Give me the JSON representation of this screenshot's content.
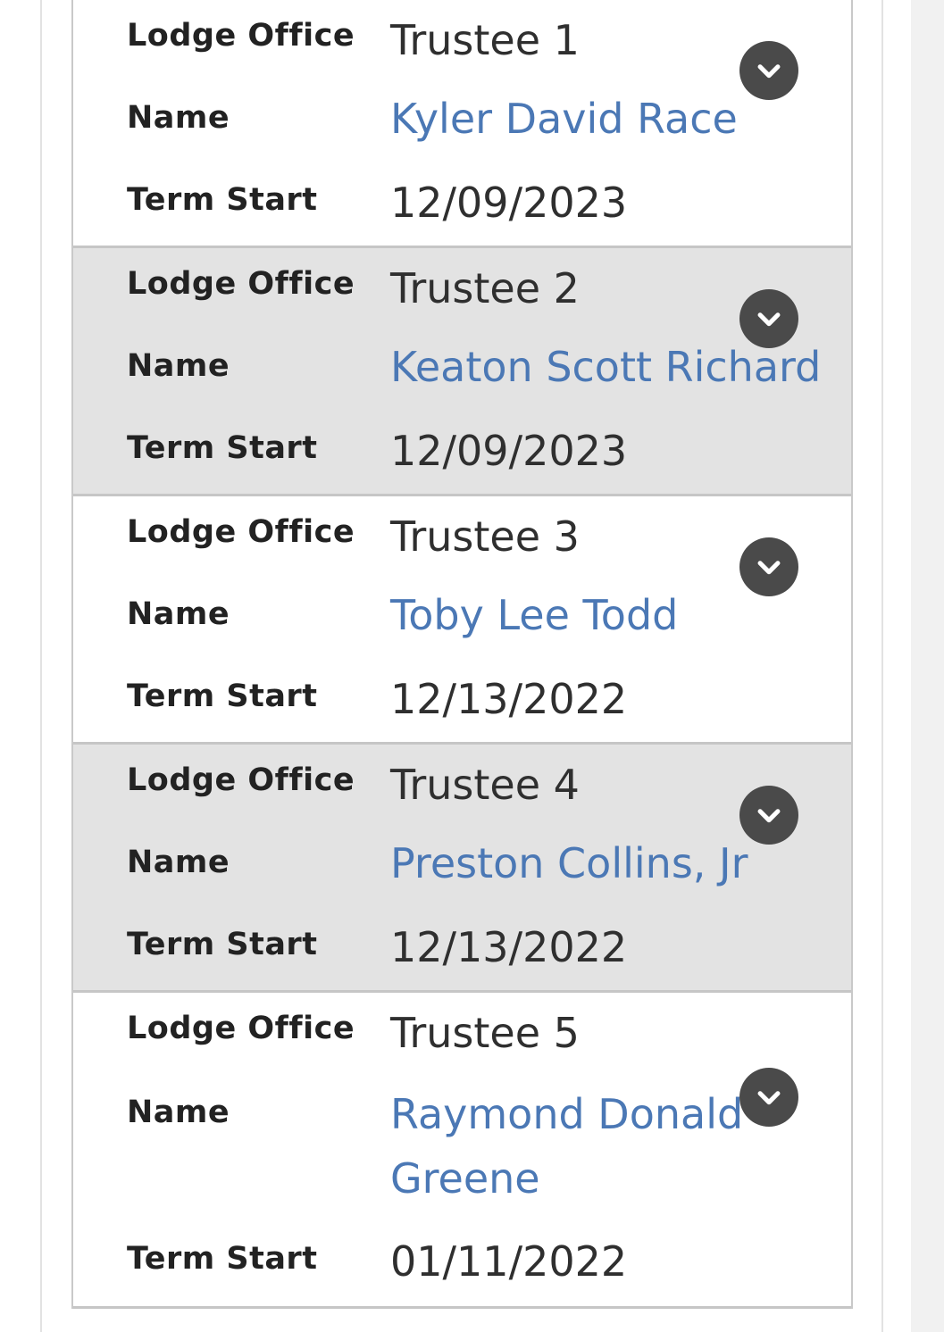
{
  "officers": [
    {
      "office_label": "Lodge Office",
      "office": "Trustee 1",
      "name_label": "Name",
      "name": "Kyler David Race",
      "term_label": "Term Start",
      "term_start": "12/09/2023",
      "expand_icon": "chevron-down-icon"
    },
    {
      "office_label": "Lodge Office",
      "office": "Trustee 2",
      "name_label": "Name",
      "name": "Keaton Scott Richard",
      "term_label": "Term Start",
      "term_start": "12/09/2023",
      "expand_icon": "chevron-down-icon"
    },
    {
      "office_label": "Lodge Office",
      "office": "Trustee 3",
      "name_label": "Name",
      "name": "Toby Lee Todd",
      "term_label": "Term Start",
      "term_start": "12/13/2022",
      "expand_icon": "chevron-down-icon"
    },
    {
      "office_label": "Lodge Office",
      "office": "Trustee 4",
      "name_label": "Name",
      "name": "Preston Collins, Jr",
      "term_label": "Term Start",
      "term_start": "12/13/2022",
      "expand_icon": "chevron-down-icon"
    },
    {
      "office_label": "Lodge Office",
      "office": "Trustee 5",
      "name_label": "Name",
      "name": "Raymond Donald Greene",
      "term_label": "Term Start",
      "term_start": "01/11/2022",
      "expand_icon": "chevron-down-icon"
    }
  ],
  "colors": {
    "link": "#4b78b5",
    "label": "#222222",
    "value": "#2f2f2f",
    "alt_row_background": "#e3e3e3",
    "expand_button": "#4a4a4a"
  }
}
